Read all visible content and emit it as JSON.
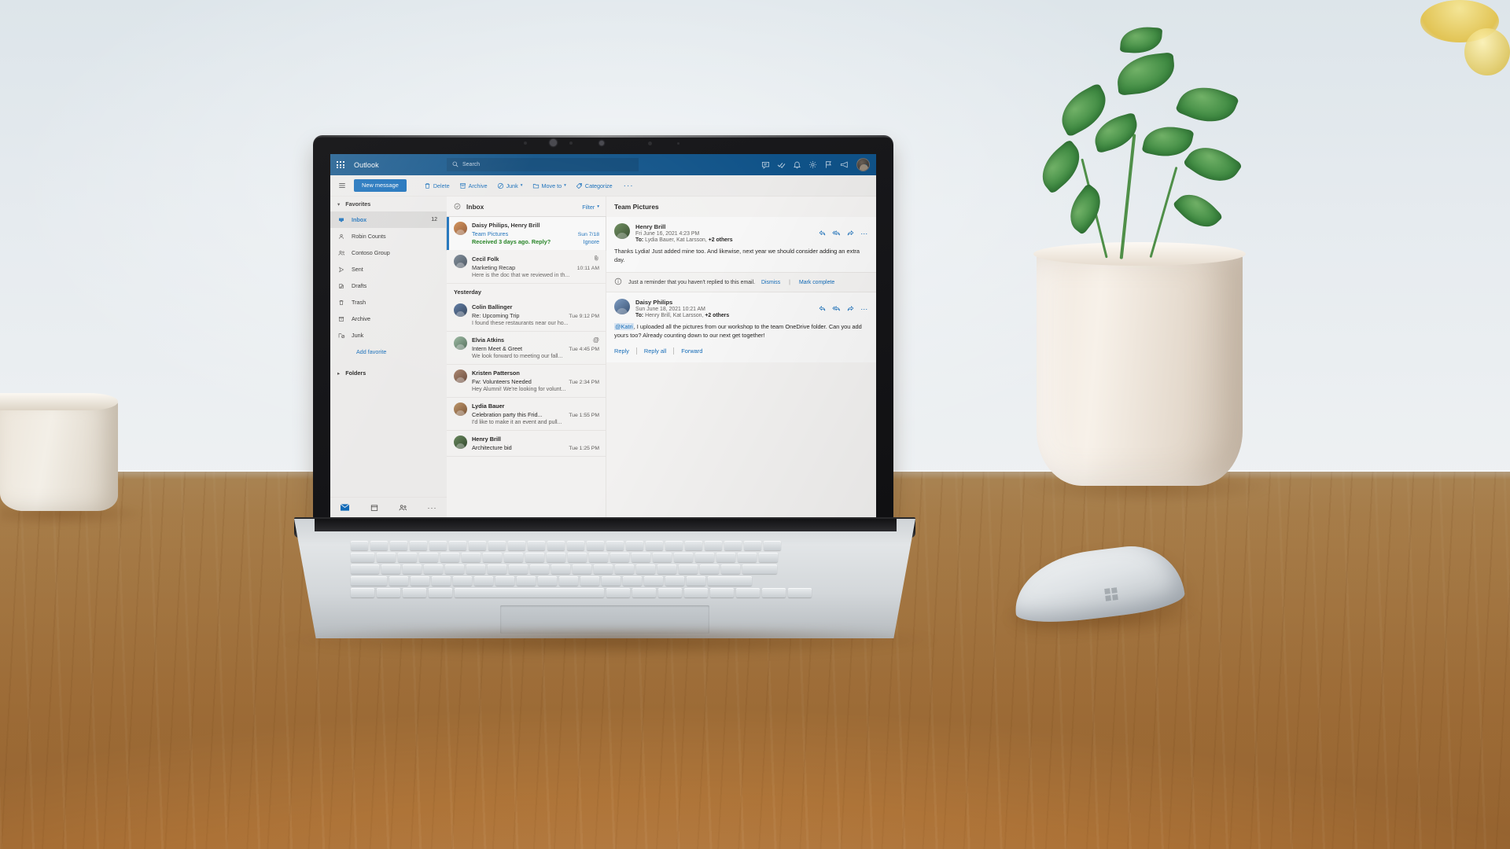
{
  "app": {
    "brand": "Outlook",
    "waffle_icon": "app-launcher-icon"
  },
  "search": {
    "icon": "search-icon",
    "placeholder": "Search",
    "value": ""
  },
  "header_icons": [
    {
      "name": "chat-icon",
      "glyph": "chat"
    },
    {
      "name": "tasks-check-icon",
      "glyph": "check"
    },
    {
      "name": "notifications-bell-icon",
      "glyph": "bell"
    },
    {
      "name": "settings-gear-icon",
      "glyph": "gear"
    },
    {
      "name": "flag-icon",
      "glyph": "flag"
    },
    {
      "name": "feedback-megaphone-icon",
      "glyph": "megaphone"
    }
  ],
  "account": {
    "avatar_name": "account-avatar",
    "presence": "available"
  },
  "commandbar": {
    "hamburger_label": "",
    "new_message_label": "New message",
    "commands": [
      {
        "label": "Delete",
        "icon": "trash-icon",
        "chevron": false
      },
      {
        "label": "Archive",
        "icon": "archive-box-icon",
        "chevron": false
      },
      {
        "label": "Junk",
        "icon": "block-circle-icon",
        "chevron": true
      },
      {
        "label": "Move to",
        "icon": "folder-icon",
        "chevron": true
      },
      {
        "label": "Categorize",
        "icon": "tag-icon",
        "chevron": false
      }
    ],
    "overflow_label": "···"
  },
  "sidebar": {
    "groups": [
      {
        "label": "Favorites",
        "expanded": true
      }
    ],
    "items": [
      {
        "label": "Inbox",
        "icon": "inbox-icon",
        "count": "12",
        "selected": true
      },
      {
        "label": "Robin Counts",
        "icon": "person-icon",
        "count": "",
        "selected": false
      },
      {
        "label": "Contoso Group",
        "icon": "people-group-icon",
        "count": "",
        "selected": false
      },
      {
        "label": "Sent",
        "icon": "send-icon",
        "count": "",
        "selected": false
      },
      {
        "label": "Drafts",
        "icon": "pencil-page-icon",
        "count": "",
        "selected": false
      },
      {
        "label": "Trash",
        "icon": "trash-icon",
        "count": "",
        "selected": false
      },
      {
        "label": "Archive",
        "icon": "archive-box-icon",
        "count": "",
        "selected": false
      },
      {
        "label": "Junk",
        "icon": "junk-block-icon",
        "count": "",
        "selected": false
      }
    ],
    "add_favorite_label": "Add favorite",
    "folders_group": {
      "label": "Folders",
      "expanded": false
    },
    "bottom_nav": [
      {
        "name": "mail-nav-icon",
        "label": "Mail",
        "active": true
      },
      {
        "name": "calendar-nav-icon",
        "label": "Calendar",
        "active": false
      },
      {
        "name": "people-nav-icon",
        "label": "People",
        "active": false
      },
      {
        "name": "more-nav-icon",
        "label": "···",
        "active": false
      }
    ]
  },
  "message_list": {
    "header": {
      "select_all_icon": "select-all-circle-icon",
      "title": "Inbox",
      "filter_label": "Filter"
    },
    "messages": [
      {
        "from": "Daisy Philips, Henry Brill",
        "subject": "Team Pictures",
        "time": "Sun 7/18",
        "preview": "",
        "nudge": "Received 3 days ago. Reply?",
        "nudge_action": "Ignore",
        "selected": true,
        "flag_icon": "",
        "avatar_color": "#c06b3e"
      },
      {
        "from": "Cecil Folk",
        "subject": "Marketing Recap",
        "time": "10:11 AM",
        "preview": "Here is the doc that we reviewed in th...",
        "nudge": "",
        "nudge_action": "",
        "selected": false,
        "flag_icon": "attachment-paperclip-icon",
        "avatar_color": "#5a6a7a"
      }
    ],
    "day_group": "Yesterday",
    "messages2": [
      {
        "from": "Colin Ballinger",
        "subject": "Re: Upcoming Trip",
        "time": "Tue 9:12 PM",
        "preview": "I found these restaurants near our ho...",
        "flag_icon": "",
        "avatar_color": "#3d5a80"
      },
      {
        "from": "Elvia Atkins",
        "subject": "Intern Meet & Greet",
        "time": "Tue 4:45 PM",
        "preview": "We look forward to meeting our fall...",
        "flag_icon": "mention-at-icon",
        "avatar_color": "#6b8f71"
      },
      {
        "from": "Kristen Patterson",
        "subject": "Fw: Volunteers Needed",
        "time": "Tue 2:34 PM",
        "preview": "Hey Alumni! We're looking for volunt...",
        "flag_icon": "",
        "avatar_color": "#8a6a5a"
      },
      {
        "from": "Lydia Bauer",
        "subject": "Celebration party this Frid...",
        "time": "Tue 1:55 PM",
        "preview": "I'd like to make it an event and pull...",
        "flag_icon": "",
        "avatar_color": "#a0744c"
      },
      {
        "from": "Henry Brill",
        "subject": "Architecture bid",
        "time": "Tue 1:25 PM",
        "preview": "",
        "flag_icon": "",
        "avatar_color": "#3f5d3f"
      }
    ]
  },
  "reading_pane": {
    "subject": "Team Pictures",
    "messages": [
      {
        "sender": "Henry Brill",
        "date": "Fri June 16, 2021 4:23 PM",
        "to_label": "To:",
        "to_names": "Lydia Bauer, Kat Larsson,",
        "to_others": "+2 others",
        "body": "Thanks Lydia! Just added mine too. And likewise, next year we should consider adding an extra day.",
        "actions": [
          "reply-icon",
          "reply-all-icon",
          "forward-icon",
          "more-actions-icon"
        ],
        "avatar_color": "#3b5a35"
      },
      {
        "sender": "Daisy Philips",
        "date": "Sun June 18, 2021 10:21 AM",
        "to_label": "To:",
        "to_names": "Henry Brill, Kat Larsson,",
        "to_others": "+2 others",
        "mention": "@Katri",
        "body": ", I uploaded all the pictures from our workshop to the team OneDrive folder. Can you add yours too? Already counting down to our next get together!",
        "actions": [
          "reply-icon",
          "reply-all-icon",
          "forward-icon",
          "more-actions-icon"
        ],
        "avatar_color": "#4b6b9a"
      }
    ],
    "notice": {
      "icon": "info-circle-icon",
      "text": "Just a reminder that you haven't replied to this email.",
      "dismiss_label": "Dismiss",
      "separator": "|",
      "mark_complete_label": "Mark complete"
    },
    "reply_bar": [
      {
        "label": "Reply",
        "name": "reply-button"
      },
      {
        "label": "Reply all",
        "name": "reply-all-button"
      },
      {
        "label": "Forward",
        "name": "forward-button"
      }
    ]
  },
  "colors": {
    "brand_blue": "#0f548c",
    "accent_blue": "#0f6cbd",
    "nudge_green": "#107c10",
    "surface": "#f3f2f1",
    "list_bg": "#faf9f8"
  }
}
